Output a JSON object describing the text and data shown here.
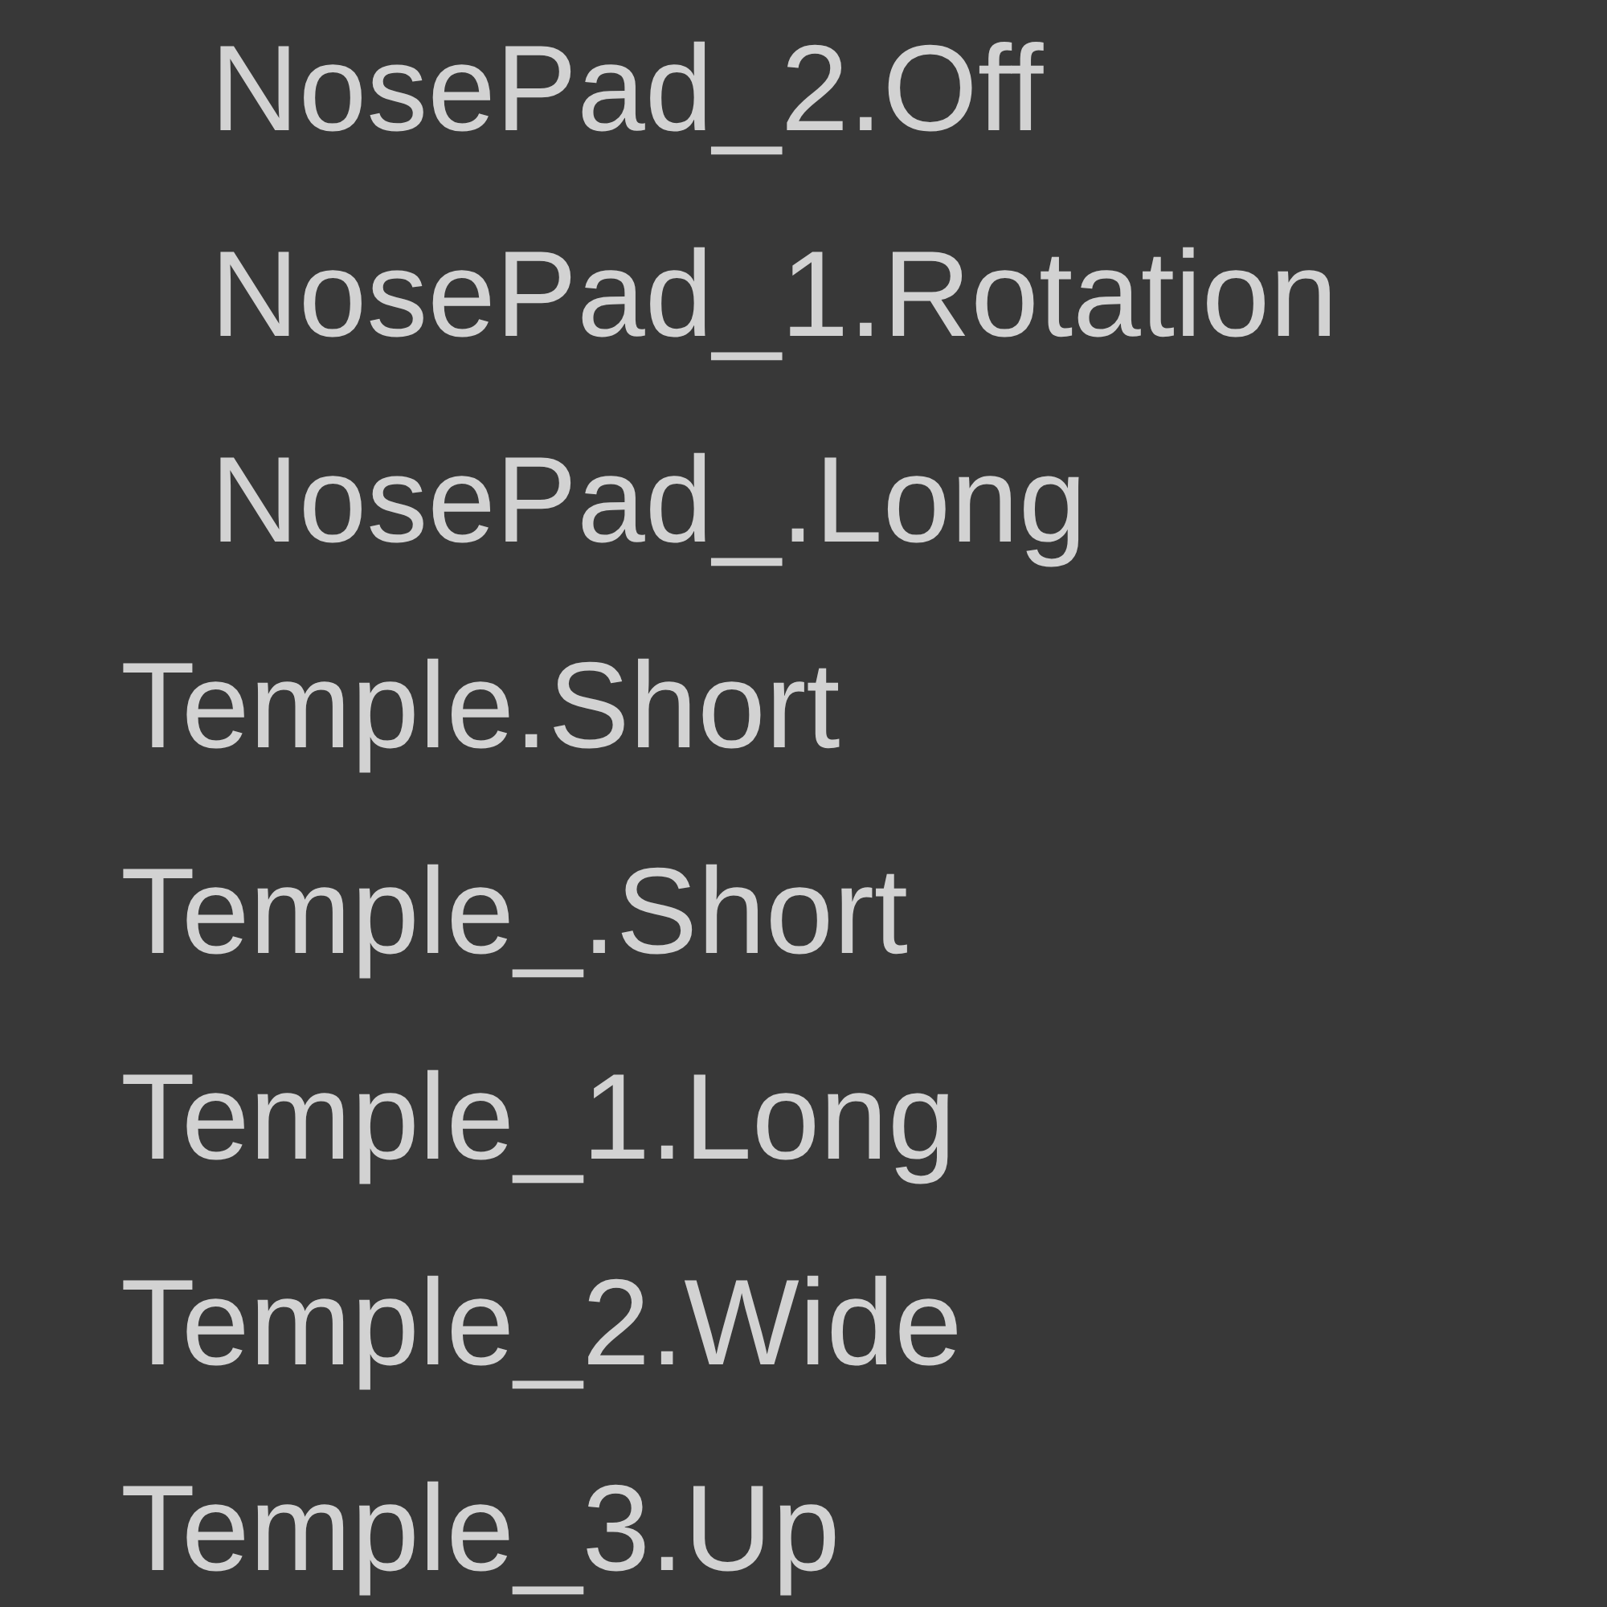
{
  "hierarchy": {
    "items": [
      {
        "children": [
          {
            "label": "NosePad_2.Off"
          },
          {
            "label": "NosePad_1.Rotation"
          },
          {
            "label": "NosePad_.Long"
          }
        ]
      },
      {
        "label": "Temple.Short"
      },
      {
        "label": "Temple_.Short"
      },
      {
        "label": "Temple_1.Long"
      },
      {
        "label": "Temple_2.Wide"
      },
      {
        "label": "Temple_3.Up"
      }
    ]
  }
}
